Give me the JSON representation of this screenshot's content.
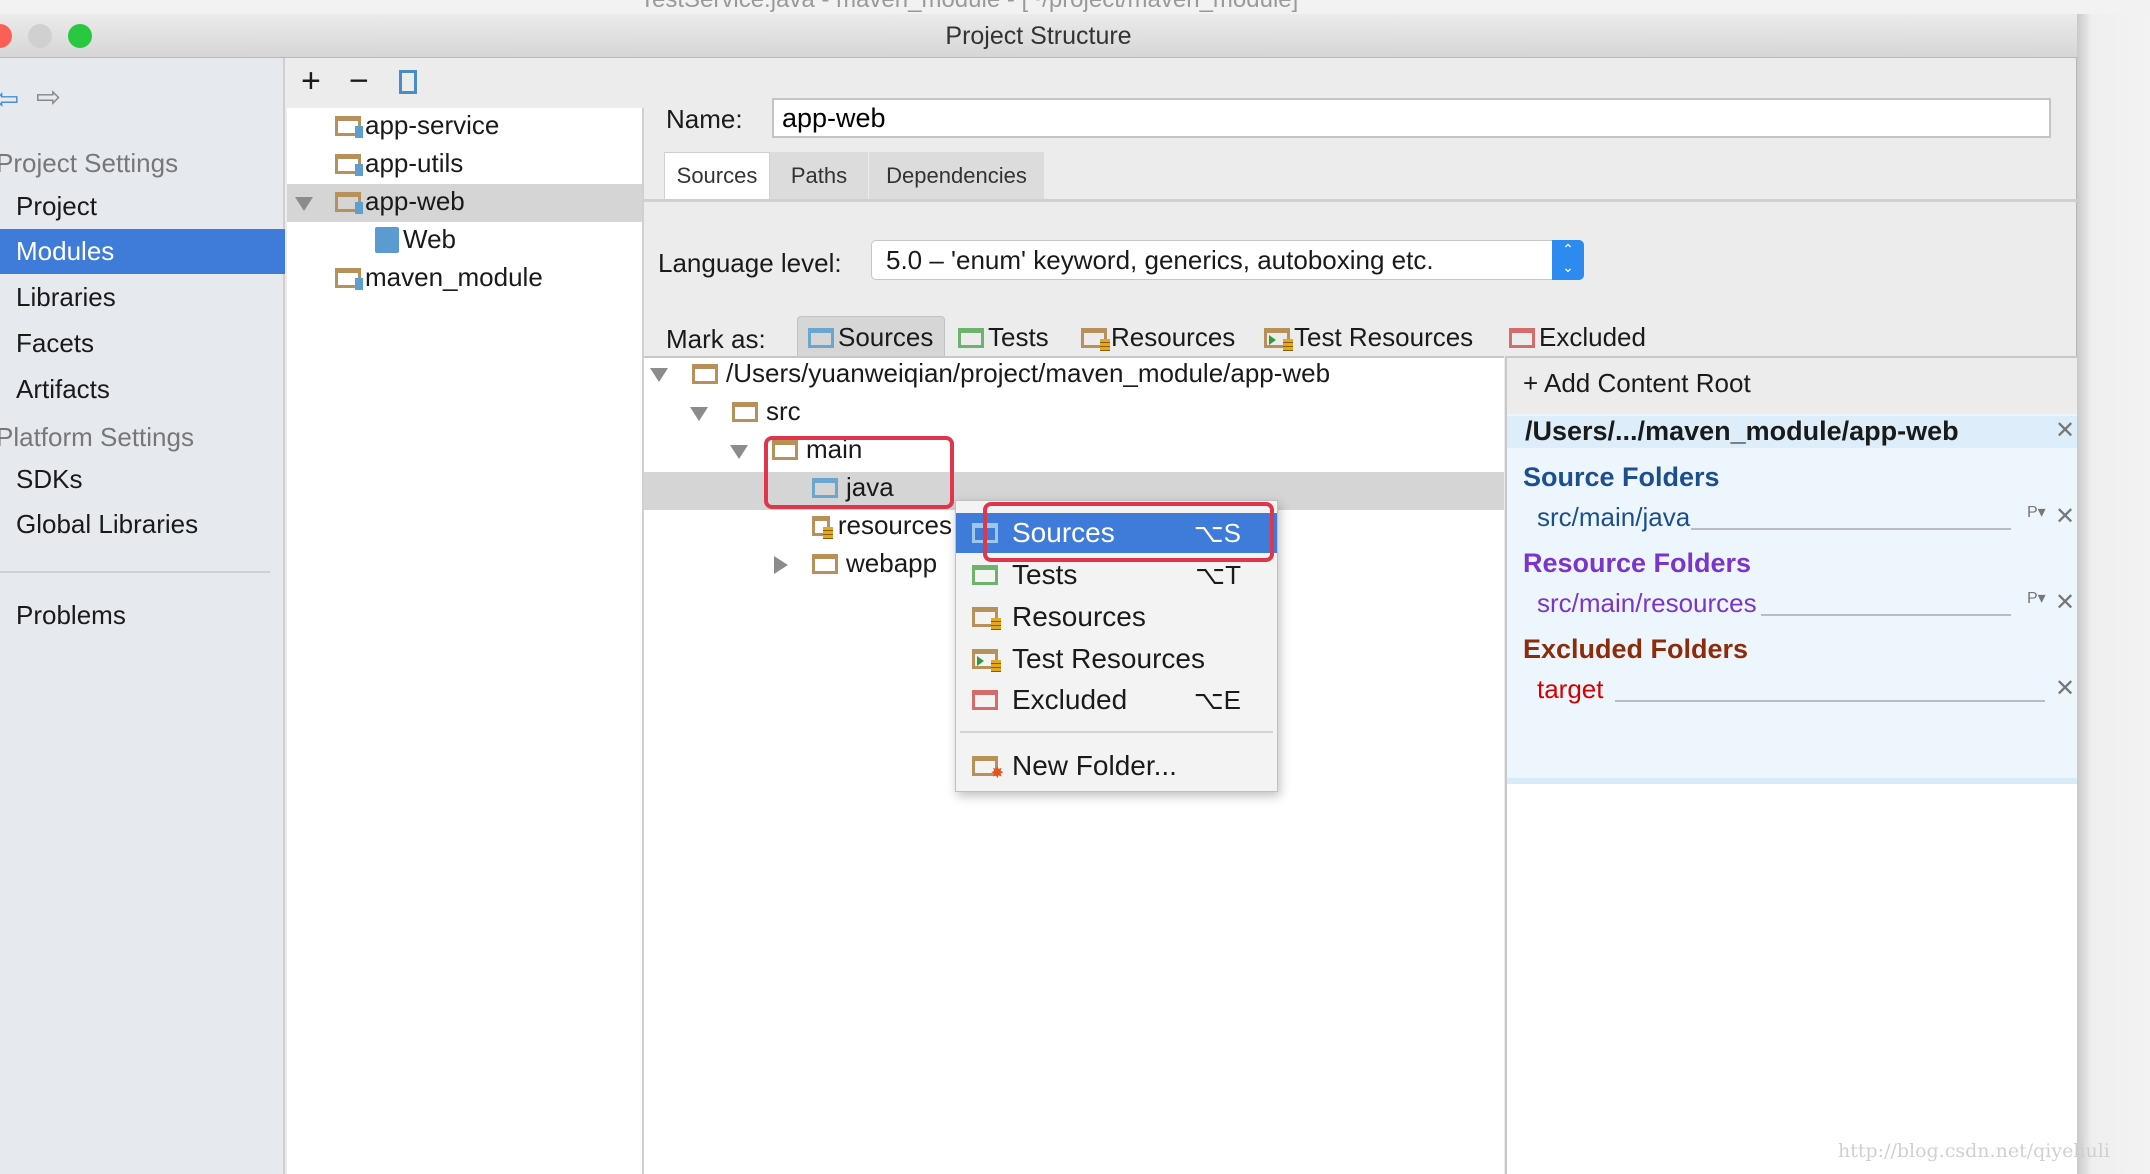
{
  "background_window": {
    "title": "TestService.java - maven_module - [~/project/maven_module]"
  },
  "dialog": {
    "title": "Project Structure"
  },
  "sidebar": {
    "project_settings_header": "Project Settings",
    "items": [
      {
        "label": "Project"
      },
      {
        "label": "Modules"
      },
      {
        "label": "Libraries"
      },
      {
        "label": "Facets"
      },
      {
        "label": "Artifacts"
      }
    ],
    "platform_settings_header": "Platform Settings",
    "platform_items": [
      {
        "label": "SDKs"
      },
      {
        "label": "Global Libraries"
      }
    ],
    "problems": "Problems",
    "selected": "Modules",
    "accent": "#3f7bd8"
  },
  "modules": {
    "toolbar": {
      "add": "+",
      "remove": "−"
    },
    "items": [
      {
        "label": "app-service"
      },
      {
        "label": "app-utils"
      },
      {
        "label": "app-web"
      },
      {
        "label": "Web"
      },
      {
        "label": "maven_module"
      }
    ],
    "selected": "app-web"
  },
  "detail": {
    "name_label": "Name:",
    "name_value": "app-web",
    "tabs": [
      {
        "label": "Sources"
      },
      {
        "label": "Paths"
      },
      {
        "label": "Dependencies"
      }
    ],
    "active_tab": "Sources",
    "language_level_label": "Language level:",
    "language_level_value": "5.0 – 'enum' keyword, generics, autoboxing etc.",
    "mark_as_label": "Mark as:",
    "mark_as": [
      {
        "label": "Sources",
        "icon": "sources-folder-icon"
      },
      {
        "label": "Tests",
        "icon": "tests-folder-icon"
      },
      {
        "label": "Resources",
        "icon": "resources-folder-icon"
      },
      {
        "label": "Test Resources",
        "icon": "test-resources-folder-icon"
      },
      {
        "label": "Excluded",
        "icon": "excluded-folder-icon"
      }
    ]
  },
  "tree": {
    "root": "/Users/yuanweiqian/project/maven_module/app-web",
    "src": "src",
    "main": "main",
    "java": "java",
    "resources": "resources",
    "webapp": "webapp"
  },
  "context_menu": {
    "items": [
      {
        "label": "Sources",
        "shortcut": "⌥S"
      },
      {
        "label": "Tests",
        "shortcut": "⌥T"
      },
      {
        "label": "Resources",
        "shortcut": ""
      },
      {
        "label": "Test Resources",
        "shortcut": ""
      },
      {
        "label": "Excluded",
        "shortcut": "⌥E"
      }
    ],
    "new_folder": "New Folder...",
    "highlighted": "Sources"
  },
  "content_root": {
    "add_label": "Add Content Root",
    "path": "/Users/.../maven_module/app-web",
    "source_header": "Source Folders",
    "source_path": "src/main/java",
    "resource_header": "Resource Folders",
    "resource_path": "src/main/resources",
    "excluded_header": "Excluded Folders",
    "excluded_path": "target",
    "colors": {
      "source": "#1c4f8f",
      "resource": "#7b35c9",
      "excluded_header": "#8b2c0b",
      "excluded_path": "#d40000"
    }
  },
  "watermark": "http://blog.csdn.net/qiyeliuli"
}
